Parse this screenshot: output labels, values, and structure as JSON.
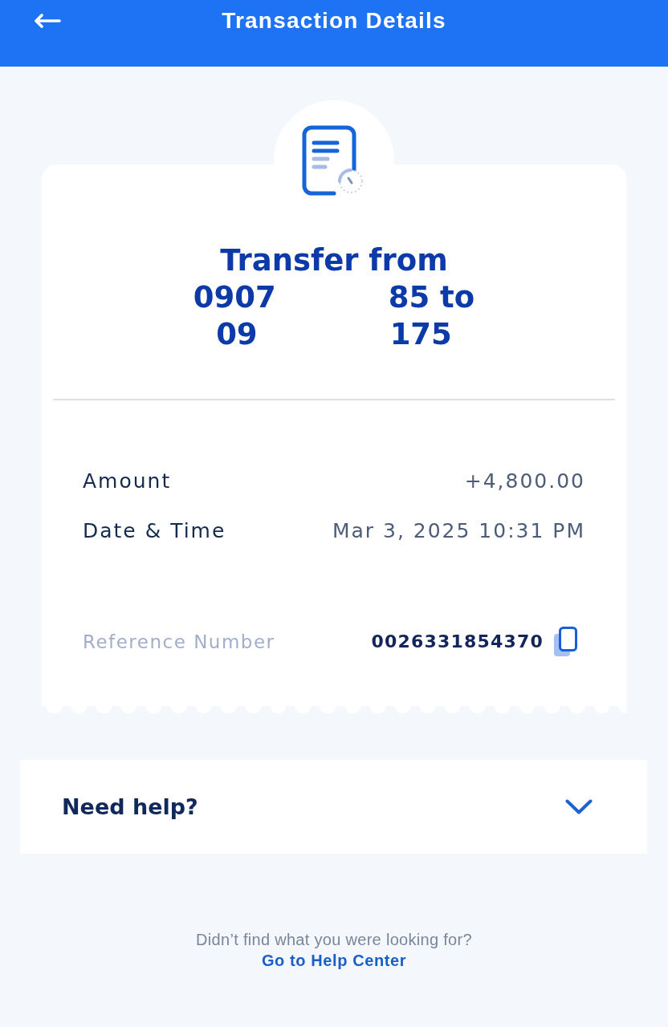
{
  "header": {
    "title": "Transaction Details"
  },
  "receipt": {
    "title_lines": [
      {
        "parts": [
          "Transfer from"
        ]
      },
      {
        "parts": [
          "0907",
          "85 to"
        ]
      },
      {
        "parts": [
          "09",
          "175"
        ]
      }
    ],
    "details": [
      {
        "kind": "info",
        "label": "Amount",
        "value": "+4,800.00"
      },
      {
        "kind": "info",
        "label": "Date & Time",
        "value": "Mar 3, 2025 10:31 PM"
      },
      {
        "kind": "reference",
        "label": "Reference Number",
        "value": "0026331854370"
      }
    ]
  },
  "help": {
    "title": "Need help?",
    "expanded": false
  },
  "footer": {
    "prompt": "Didn’t find what you were looking for?",
    "link": "Go to Help Center"
  }
}
